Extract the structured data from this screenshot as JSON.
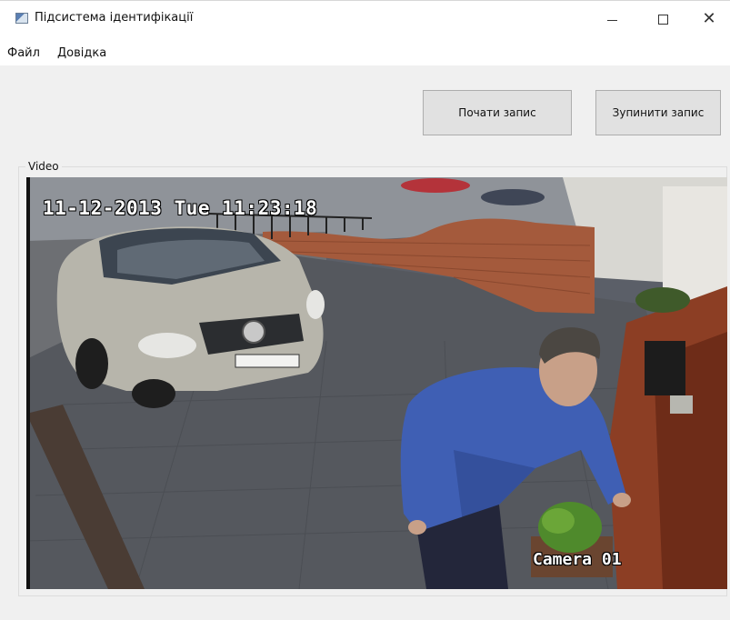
{
  "window": {
    "title": "Підсистема ідентифікації",
    "icon": "app-window-icon",
    "controls": {
      "minimize": "minimize-icon",
      "maximize": "maximize-icon",
      "close": "close-icon"
    }
  },
  "menu": {
    "items": [
      {
        "label": "Файл"
      },
      {
        "label": "Довідка"
      }
    ]
  },
  "toolbar": {
    "start_label": "Почати запис",
    "stop_label": "Зупинити запис"
  },
  "video_group": {
    "label": "Video",
    "timestamp": "11-12-2013 Tue 11:23:18",
    "camera": "Camera 01"
  },
  "colors": {
    "window_bg": "#f0f0f0",
    "button_bg": "#e1e1e1",
    "button_border": "#adadad"
  }
}
